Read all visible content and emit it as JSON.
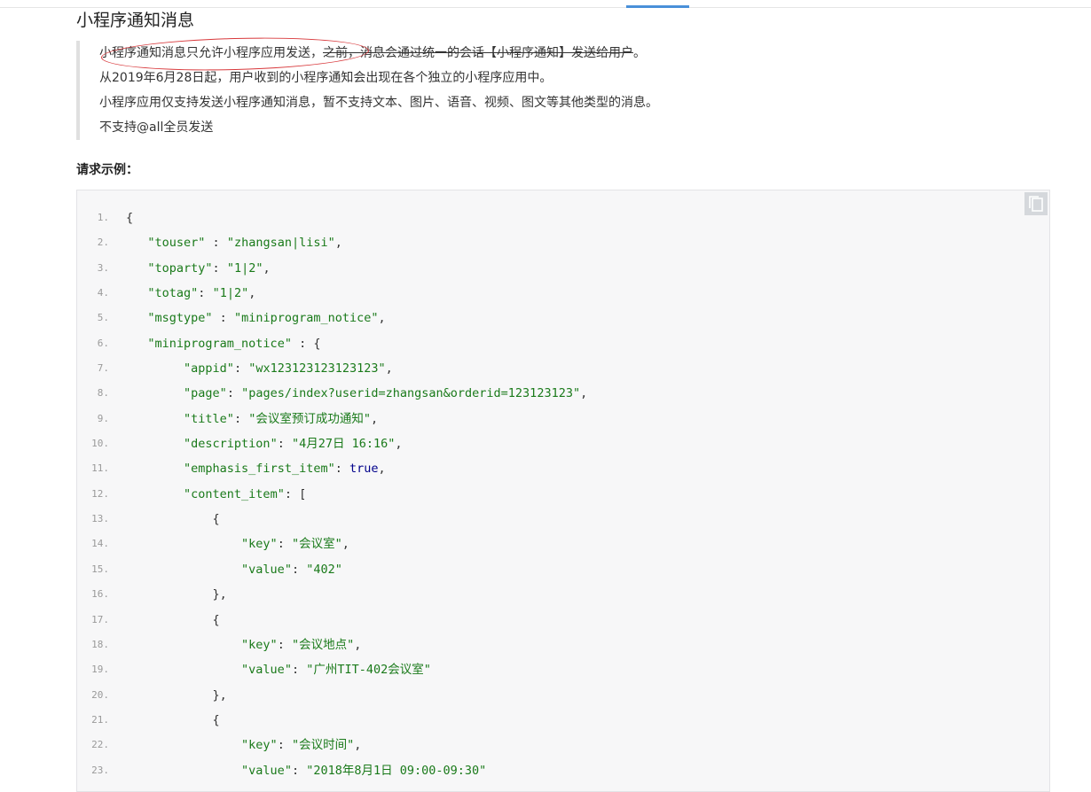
{
  "section_title": "小程序通知消息",
  "note": {
    "line1_circled": "小程序通知消息只允许小程序应用发送",
    "line1_comma": "，",
    "line1_struck": "之前，消息会通过统一的会话【小程序通知】发送给用户",
    "line1_end": "。",
    "line2": "从2019年6月28日起，用户收到的小程序通知会出现在各个独立的小程序应用中。",
    "line3": "小程序应用仅支持发送小程序通知消息，暂不支持文本、图片、语音、视频、图文等其他类型的消息。",
    "line4": "不支持@all全员发送"
  },
  "request_example_label": "请求示例：",
  "copy_icon": "copy-icon",
  "colors": {
    "string": "#1a7a1a",
    "keyword": "#00008b",
    "line_number": "#999999",
    "annotation": "#d8383b",
    "tab_accent": "#4a90d9"
  },
  "code_lines": [
    [
      [
        "",
        "{"
      ]
    ],
    [
      [
        "",
        "   "
      ],
      [
        "str",
        "\"touser\""
      ],
      [
        "",
        " : "
      ],
      [
        "str",
        "\"zhangsan|lisi\""
      ],
      [
        "",
        ","
      ]
    ],
    [
      [
        "",
        "   "
      ],
      [
        "str",
        "\"toparty\""
      ],
      [
        "",
        ": "
      ],
      [
        "str",
        "\"1|2\""
      ],
      [
        "",
        ","
      ]
    ],
    [
      [
        "",
        "   "
      ],
      [
        "str",
        "\"totag\""
      ],
      [
        "",
        ": "
      ],
      [
        "str",
        "\"1|2\""
      ],
      [
        "",
        ","
      ]
    ],
    [
      [
        "",
        "   "
      ],
      [
        "str",
        "\"msgtype\""
      ],
      [
        "",
        " : "
      ],
      [
        "str",
        "\"miniprogram_notice\""
      ],
      [
        "",
        ","
      ]
    ],
    [
      [
        "",
        "   "
      ],
      [
        "str",
        "\"miniprogram_notice\""
      ],
      [
        "",
        " : {"
      ]
    ],
    [
      [
        "",
        "        "
      ],
      [
        "str",
        "\"appid\""
      ],
      [
        "",
        ": "
      ],
      [
        "str",
        "\"wx123123123123123\""
      ],
      [
        "",
        ","
      ]
    ],
    [
      [
        "",
        "        "
      ],
      [
        "str",
        "\"page\""
      ],
      [
        "",
        ": "
      ],
      [
        "str",
        "\"pages/index?userid=zhangsan&orderid=123123123\""
      ],
      [
        "",
        ","
      ]
    ],
    [
      [
        "",
        "        "
      ],
      [
        "str",
        "\"title\""
      ],
      [
        "",
        ": "
      ],
      [
        "str",
        "\"会议室预订成功通知\""
      ],
      [
        "",
        ","
      ]
    ],
    [
      [
        "",
        "        "
      ],
      [
        "str",
        "\"description\""
      ],
      [
        "",
        ": "
      ],
      [
        "str",
        "\"4月27日 16:16\""
      ],
      [
        "",
        ","
      ]
    ],
    [
      [
        "",
        "        "
      ],
      [
        "str",
        "\"emphasis_first_item\""
      ],
      [
        "",
        ": "
      ],
      [
        "kw",
        "true"
      ],
      [
        "",
        ","
      ]
    ],
    [
      [
        "",
        "        "
      ],
      [
        "str",
        "\"content_item\""
      ],
      [
        "",
        ": ["
      ]
    ],
    [
      [
        "",
        "            {"
      ]
    ],
    [
      [
        "",
        "                "
      ],
      [
        "str",
        "\"key\""
      ],
      [
        "",
        ": "
      ],
      [
        "str",
        "\"会议室\""
      ],
      [
        "",
        ","
      ]
    ],
    [
      [
        "",
        "                "
      ],
      [
        "str",
        "\"value\""
      ],
      [
        "",
        ": "
      ],
      [
        "str",
        "\"402\""
      ]
    ],
    [
      [
        "",
        "            },"
      ]
    ],
    [
      [
        "",
        "            {"
      ]
    ],
    [
      [
        "",
        "                "
      ],
      [
        "str",
        "\"key\""
      ],
      [
        "",
        ": "
      ],
      [
        "str",
        "\"会议地点\""
      ],
      [
        "",
        ","
      ]
    ],
    [
      [
        "",
        "                "
      ],
      [
        "str",
        "\"value\""
      ],
      [
        "",
        ": "
      ],
      [
        "str",
        "\"广州TIT-402会议室\""
      ]
    ],
    [
      [
        "",
        "            },"
      ]
    ],
    [
      [
        "",
        "            {"
      ]
    ],
    [
      [
        "",
        "                "
      ],
      [
        "str",
        "\"key\""
      ],
      [
        "",
        ": "
      ],
      [
        "str",
        "\"会议时间\""
      ],
      [
        "",
        ","
      ]
    ],
    [
      [
        "",
        "                "
      ],
      [
        "str",
        "\"value\""
      ],
      [
        "",
        ": "
      ],
      [
        "str",
        "\"2018年8月1日 09:00-09:30\""
      ]
    ]
  ]
}
